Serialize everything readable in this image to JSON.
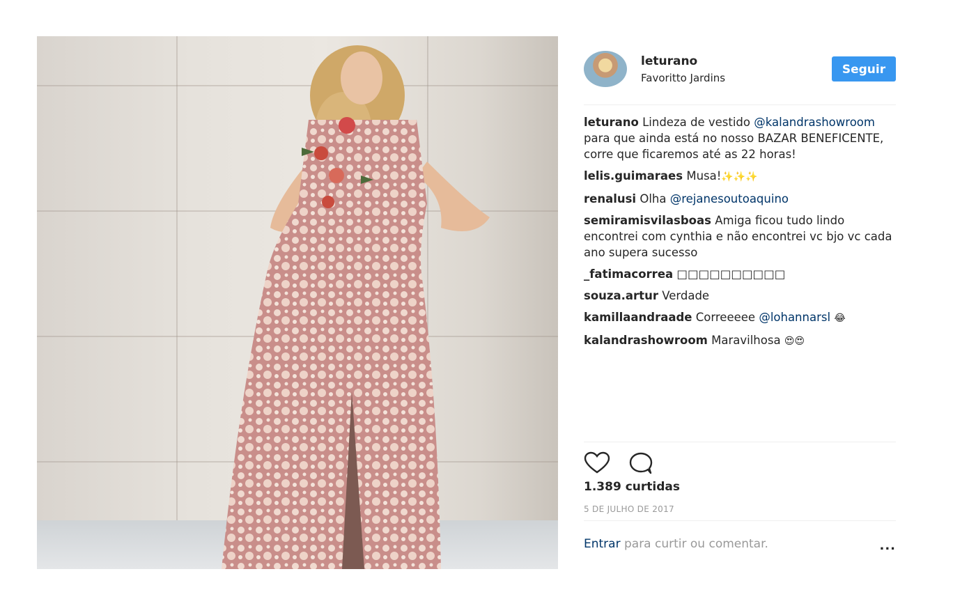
{
  "post": {
    "image_alt": "Photo of woman in pink lace gown",
    "likes": "1.389 curtidas",
    "date": "5 DE JULHO DE 2017"
  },
  "header": {
    "username": "leturano",
    "location": "Favoritto Jardins",
    "follow_label": "Seguir"
  },
  "caption": {
    "author": "leturano",
    "text_1": "Lindeza de vestido ",
    "mention": "@kalandrashowroom",
    "text_2": " para que ainda está no nosso BAZAR BENEFICENTE, corre que ficaremos até as 22 horas!"
  },
  "comments": [
    {
      "author": "lelis.guimaraes",
      "text": "Musa!",
      "emoji": "✨✨✨"
    },
    {
      "author": "renalusi",
      "text": "Olha ",
      "mention": "@rejanesoutoaquino"
    },
    {
      "author": "semiramisvilasboas",
      "text": "Amiga ficou tudo lindo encontrei com cynthia e não encontrei vc bjo vc cada ano supera sucesso"
    },
    {
      "author": "_fatimacorrea",
      "text": "□□□□□□□□□□"
    },
    {
      "author": "souza.artur",
      "text": "Verdade"
    },
    {
      "author": "kamillaandraade",
      "text": "Correeeee ",
      "mention": "@lohannarsl",
      "emoji": "😂"
    },
    {
      "author": "kalandrashowroom",
      "text": "Maravilhosa ",
      "emoji": "😍😍"
    }
  ],
  "footer": {
    "login_link": "Entrar",
    "login_text": " para curtir ou comentar.",
    "more_label": "..."
  },
  "icons": {
    "like": "heart-icon",
    "comment": "comment-bubble-icon",
    "more": "ellipsis-icon"
  },
  "colors": {
    "accent": "#3897f0",
    "mention": "#003569",
    "muted": "#999999"
  }
}
